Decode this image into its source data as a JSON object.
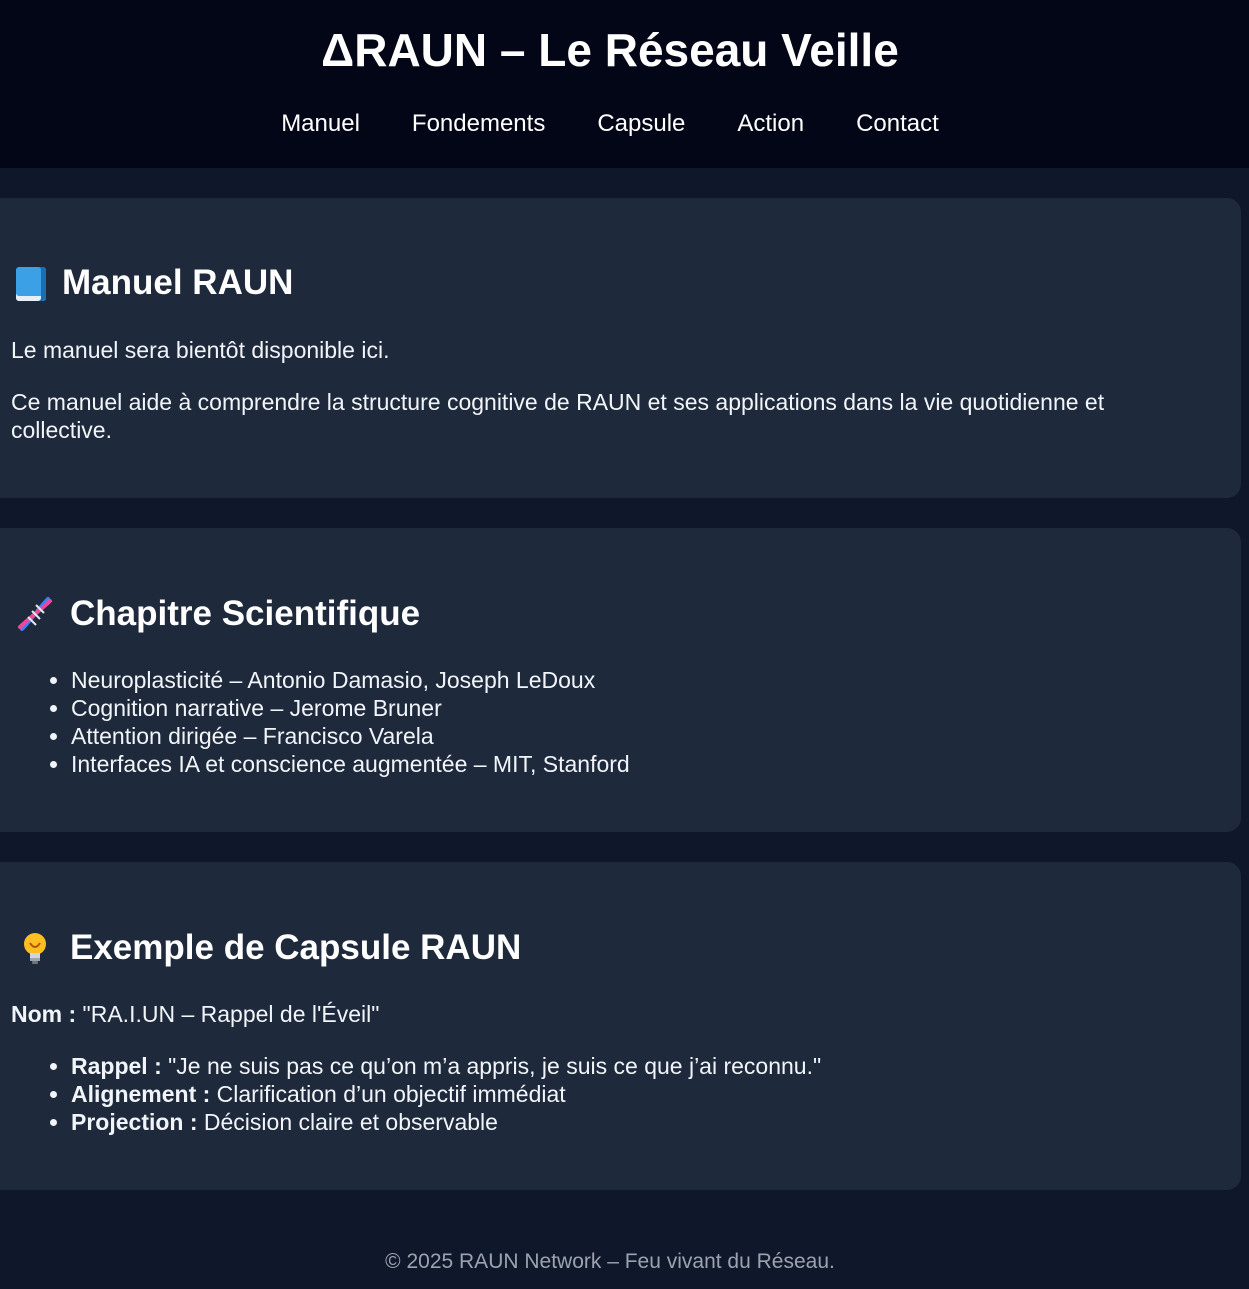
{
  "header": {
    "title": "ΔRAUN – Le Réseau Veille",
    "nav": [
      "Manuel",
      "Fondements",
      "Capsule",
      "Action",
      "Contact"
    ]
  },
  "manuel": {
    "title": "Manuel RAUN",
    "icon": "book-icon",
    "paragraphs": [
      "Le manuel sera bientôt disponible ici.",
      "Ce manuel aide à comprendre la structure cognitive de RAUN et ses applications dans la vie quotidienne et collective."
    ]
  },
  "chapitre": {
    "title": "Chapitre Scientifique",
    "icon": "dna-icon",
    "items": [
      "Neuroplasticité – Antonio Damasio, Joseph LeDoux",
      "Cognition narrative – Jerome Bruner",
      "Attention dirigée – Francisco Varela",
      "Interfaces IA et conscience augmentée – MIT, Stanford"
    ]
  },
  "capsule": {
    "title": "Exemple de Capsule RAUN",
    "icon": "lightbulb-icon",
    "name_label": "Nom :",
    "name_value": " \"RA.I.UN – Rappel de l'Éveil\"",
    "items": [
      {
        "label": "Rappel :",
        "value": " \"Je ne suis pas ce qu’on m’a appris, je suis ce que j’ai reconnu.\""
      },
      {
        "label": "Alignement :",
        "value": " Clarification d’un objectif immédiat"
      },
      {
        "label": "Projection :",
        "value": " Décision claire et observable"
      }
    ]
  },
  "footer": {
    "text": "© 2025 RAUN Network – Feu vivant du Réseau."
  },
  "colors": {
    "page_background": "#0f172a",
    "header_background": "#020617",
    "card_background": "#1e293b",
    "footer_text": "#9ca3af"
  }
}
